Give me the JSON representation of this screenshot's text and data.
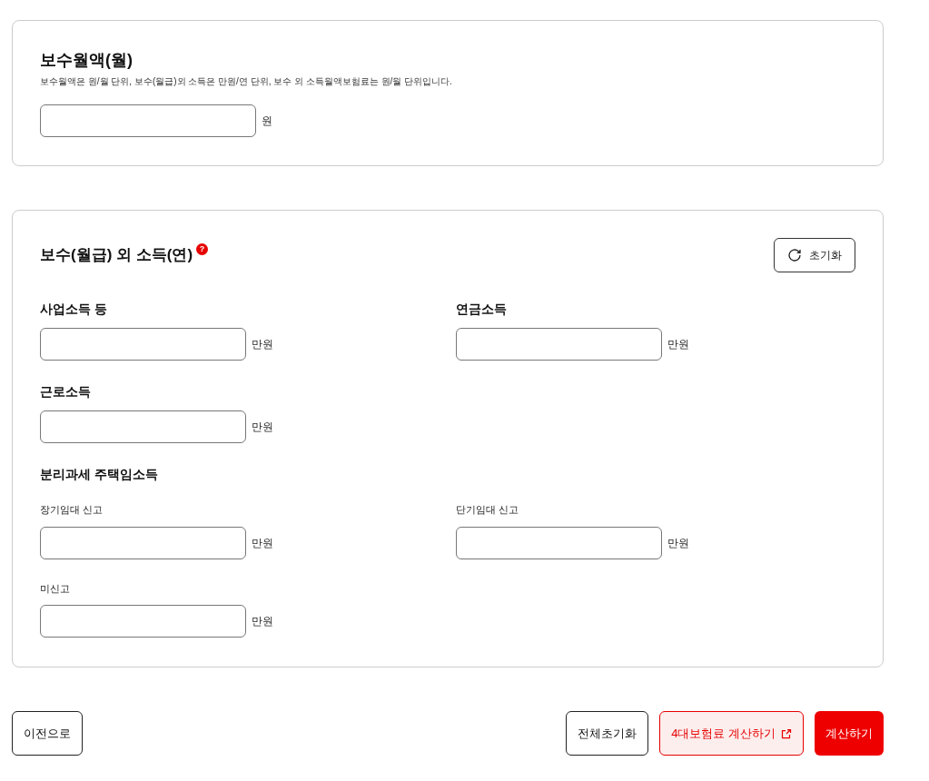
{
  "salary": {
    "title": "보수월액(월)",
    "note": "보수월액은 원/월 단위, 보수(월급)외 소득은 만원/연 단위, 보수 외 소득월액보험료는 원/월 단위입니다.",
    "unit": "원"
  },
  "income": {
    "title": "보수(월급) 외 소득(연)",
    "help": "?",
    "reset_button": "초기화",
    "rows": [
      {
        "kind": "fields",
        "cells": [
          {
            "label": "사업소득 등",
            "unit": "만원",
            "kind": "main"
          },
          {
            "label": "연금소득",
            "unit": "만원",
            "kind": "main"
          }
        ]
      },
      {
        "kind": "fields",
        "cells": [
          {
            "label": "근로소득",
            "unit": "만원",
            "kind": "main"
          }
        ]
      },
      {
        "kind": "heading",
        "label": "분리과세 주택임소득"
      },
      {
        "kind": "fields",
        "cells": [
          {
            "label": "장기임대 신고",
            "unit": "만원",
            "kind": "sub"
          },
          {
            "label": "단기임대 신고",
            "unit": "만원",
            "kind": "sub"
          }
        ]
      },
      {
        "kind": "fields",
        "cells": [
          {
            "label": "미신고",
            "unit": "만원",
            "kind": "sub"
          }
        ]
      }
    ]
  },
  "footer": {
    "back": "이전으로",
    "reset_all": "전체초기화",
    "external": "4대보험료 계산하기",
    "submit": "계산하기"
  }
}
